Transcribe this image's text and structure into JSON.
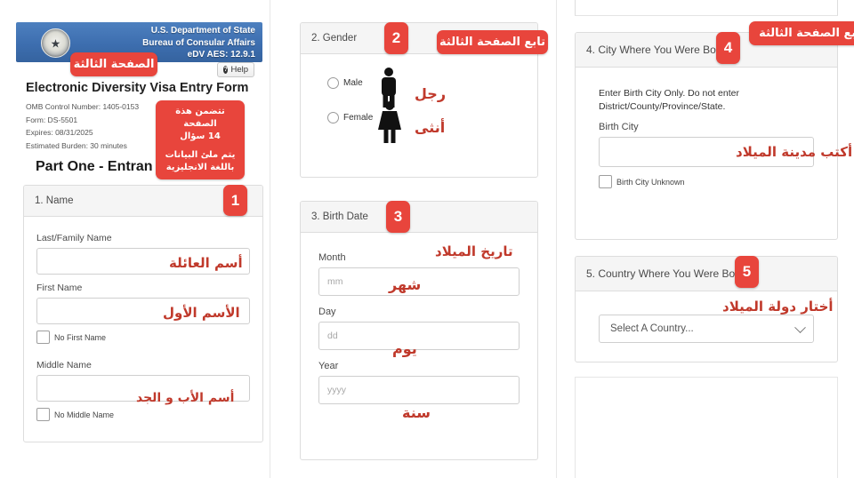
{
  "layout": {
    "columns": 3,
    "note": "three screenshot fragments of the DV lottery entry form side by side"
  },
  "colors": {
    "annotation_red": "#e8453c",
    "arabic_text_red": "#c0392b",
    "banner_blue": "#3d6eaf",
    "panel_header": "#f5f5f5"
  },
  "column1": {
    "banner": {
      "line1": "U.S. Department of State",
      "line2": "Bureau of Consular Affairs",
      "line3": "eDV AES: 12.9.1",
      "seal_icon": "us-department-of-state-seal"
    },
    "help_button": {
      "label": "Help",
      "icon": "question-mark-icon"
    },
    "page_title": "Electronic Diversity Visa Entry Form",
    "meta_lines": [
      "OMB Control Number: 1405-0153",
      "Form: DS-5501",
      "Expires: 08/31/2025",
      "Estimated Burden: 30 minutes"
    ],
    "part_title": "Part One - Entran",
    "callout_page": "الصفحة الثالثة",
    "callout_info": {
      "line1": "تتضمن هذة الصفحة",
      "line2": "14 سؤال",
      "line3": "يتم ملئ البيانات",
      "line4": "باللغة الانجليزية"
    },
    "section1": {
      "badge": "1",
      "header": "1. Name",
      "fields": [
        {
          "label": "Last/Family Name",
          "value": "",
          "arabic": "أسم العائلة"
        },
        {
          "label": "First Name",
          "value": "",
          "arabic": "الأسم الأول"
        },
        {
          "label": "Middle Name",
          "value": "",
          "arabic": "أسم الأب و الجد"
        }
      ],
      "checkboxes": [
        {
          "label": "No First Name",
          "checked": false
        },
        {
          "label": "No Middle Name",
          "checked": false
        }
      ]
    }
  },
  "column2": {
    "callout_page": "تابع الصفحة الثالثة",
    "section2": {
      "badge": "2",
      "header": "2. Gender",
      "options": [
        {
          "label": "Male",
          "arabic": "رجل",
          "icon": "male-figure-icon",
          "selected": false
        },
        {
          "label": "Female",
          "arabic": "أنثى",
          "icon": "female-figure-icon",
          "selected": false
        }
      ]
    },
    "section3": {
      "badge": "3",
      "header": "3. Birth Date",
      "arabic_title": "تاريخ الميلاد",
      "fields": [
        {
          "label": "Month",
          "placeholder": "mm",
          "value": "",
          "arabic": "شهر"
        },
        {
          "label": "Day",
          "placeholder": "dd",
          "value": "",
          "arabic": "يوم"
        },
        {
          "label": "Year",
          "placeholder": "yyyy",
          "value": "",
          "arabic": "سنة"
        }
      ]
    }
  },
  "column3": {
    "callout_page": "تابع الصفحة الثالثة",
    "section4": {
      "badge": "4",
      "header": "4. City Where You Were Born",
      "instruction_line1": "Enter Birth City Only. Do not enter",
      "instruction_line2": "District/County/Province/State.",
      "field": {
        "label": "Birth City",
        "value": "",
        "arabic": "أكتب مدينة الميلاد"
      },
      "checkbox": {
        "label": "Birth City Unknown",
        "checked": false
      }
    },
    "section5": {
      "badge": "5",
      "header": "5. Country Where You Were Born",
      "arabic_title": "أختار دولة الميلاد",
      "select": {
        "value": "Select A Country...",
        "caret_icon": "chevron-down-icon"
      }
    }
  }
}
